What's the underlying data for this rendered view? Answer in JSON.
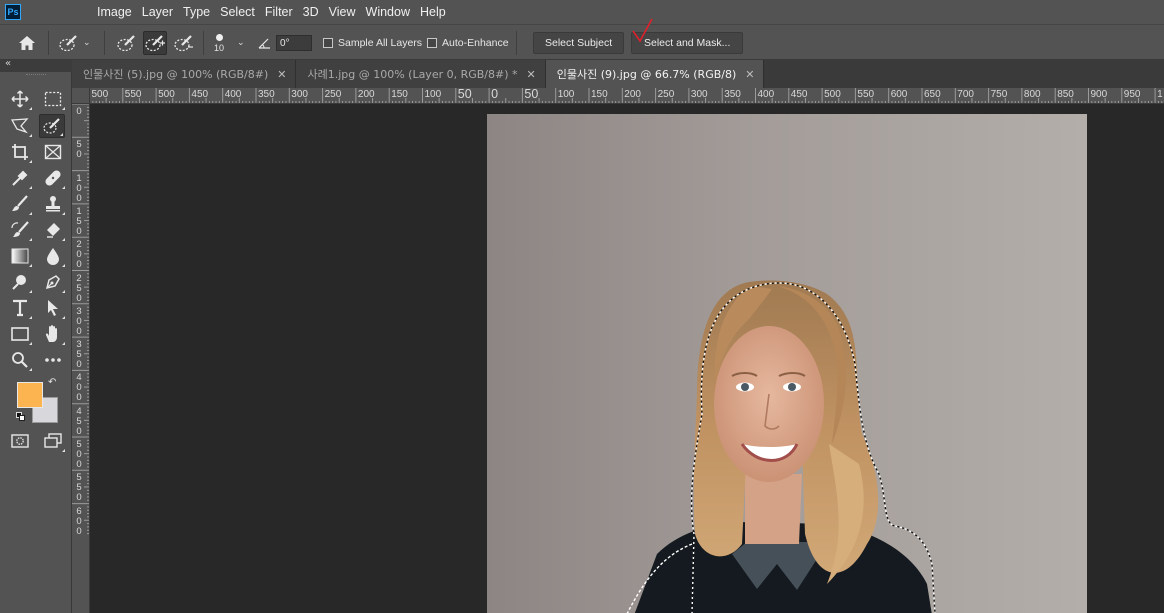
{
  "app": {
    "logo": "Ps"
  },
  "menu": [
    "Image",
    "Layer",
    "Type",
    "Select",
    "Filter",
    "3D",
    "View",
    "Window",
    "Help"
  ],
  "options": {
    "brush_size": "10",
    "angle_value": "0°",
    "sample_all_layers": "Sample All Layers",
    "auto_enhance": "Auto-Enhance",
    "select_subject": "Select Subject",
    "select_and_mask": "Select and Mask..."
  },
  "tabs": [
    {
      "label": "인물사진 (5).jpg @ 100% (RGB/8#)",
      "active": false
    },
    {
      "label": "사례1.jpg @ 100% (Layer 0, RGB/8#) *",
      "active": false
    },
    {
      "label": "인물사진 (9).jpg @ 66.7% (RGB/8)",
      "active": true
    }
  ],
  "ruler_top": [
    "500",
    "550",
    "500",
    "450",
    "400",
    "350",
    "300",
    "250",
    "200",
    "150",
    "100",
    "50",
    "0",
    "50",
    "100",
    "150",
    "200",
    "250",
    "300",
    "350",
    "400",
    "450",
    "500",
    "550",
    "600",
    "650",
    "700",
    "750",
    "800",
    "850",
    "900",
    "950",
    "1"
  ],
  "ruler_left": [
    "0",
    "5\n0",
    "1\n0\n0",
    "1\n5\n0",
    "2\n0\n0",
    "2\n5\n0",
    "3\n0\n0",
    "3\n5\n0",
    "4\n0\n0",
    "4\n5\n0",
    "5\n0\n0",
    "5\n5\n0",
    "6\n0\n0"
  ],
  "colors": {
    "foreground": "#fbb44f",
    "background": "#d7d7dc",
    "annotation": "#e0202a"
  },
  "icons": {
    "home": "home-icon",
    "quick_selection": "quick-selection-brush-icon"
  }
}
